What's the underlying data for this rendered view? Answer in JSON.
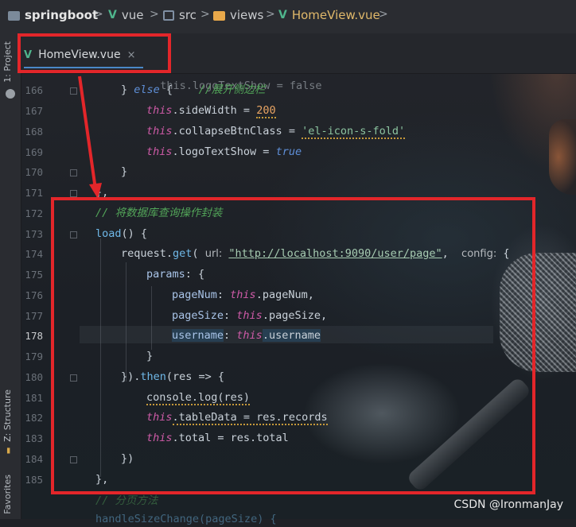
{
  "breadcrumb": {
    "items": [
      {
        "label": "springboot",
        "icon": "folder-icon"
      },
      {
        "label": "vue",
        "icon": "vue-icon"
      },
      {
        "label": "src",
        "icon": "src-folder-icon"
      },
      {
        "label": "views",
        "icon": "folder-icon"
      },
      {
        "label": "HomeView.vue",
        "icon": "vue-file-icon"
      }
    ],
    "separator": ">"
  },
  "left_strip": {
    "project_label": "1: Project",
    "structure_label": "Z: Structure",
    "favorites_label": "Favorites"
  },
  "tab": {
    "label": "HomeView.vue",
    "close": "×",
    "icon": "vue-icon"
  },
  "editor": {
    "lines": [
      {
        "num": "166",
        "text_a": "} ",
        "kw": "else",
        "text_b": " {    ",
        "comment": "//展开侧边栏"
      },
      {
        "num": "167",
        "this": "this",
        "prop": ".sideWidth = ",
        "value": "200"
      },
      {
        "num": "168",
        "this": "this",
        "prop": ".collapseBtnClass = ",
        "value": "'el-icon-s-fold'"
      },
      {
        "num": "169",
        "this": "this",
        "prop": ".logoTextShow = ",
        "value": "true"
      },
      {
        "num": "170",
        "text": "}"
      },
      {
        "num": "171",
        "text": "},"
      },
      {
        "num": "172",
        "comment": "// 将数据库查询操作封装"
      },
      {
        "num": "173",
        "fn": "load",
        "text": "() {"
      },
      {
        "num": "174",
        "obj": "request.",
        "fn": "get",
        "open": "(",
        "hint_url": "url:",
        "url": "\"http://localhost:9090/user/page\"",
        "sep": ",",
        "hint_config": "config:",
        "close": "{"
      },
      {
        "num": "175",
        "prop": "params",
        "text": ": {"
      },
      {
        "num": "176",
        "key": "pageNum",
        "this": "this",
        "rest": ".pageNum,"
      },
      {
        "num": "177",
        "key": "pageSize",
        "this": "this",
        "rest": ".pageSize,"
      },
      {
        "num": "178",
        "key": "username",
        "this": "this",
        "rest": ".username"
      },
      {
        "num": "179",
        "text": "}"
      },
      {
        "num": "180",
        "text_a": "}).",
        "fn": "then",
        "text_b": "(res => {"
      },
      {
        "num": "181",
        "text": "console.log(res)"
      },
      {
        "num": "182",
        "this": "this",
        "rest": ".tableData = res.records"
      },
      {
        "num": "183",
        "this": "this",
        "rest": ".total = res.total"
      },
      {
        "num": "184",
        "text": "})"
      },
      {
        "num": "185",
        "text": "},"
      }
    ],
    "top_partial": "this.logoTextShow = false",
    "bottom_partial_comment": "// 分页方法",
    "bottom_partial_code": "handleSizeChange(pageSize) {"
  },
  "watermark": "CSDN @IronmanJay",
  "colors": {
    "annotation_red": "#e3262a",
    "accent_blue": "#4a88c7"
  }
}
